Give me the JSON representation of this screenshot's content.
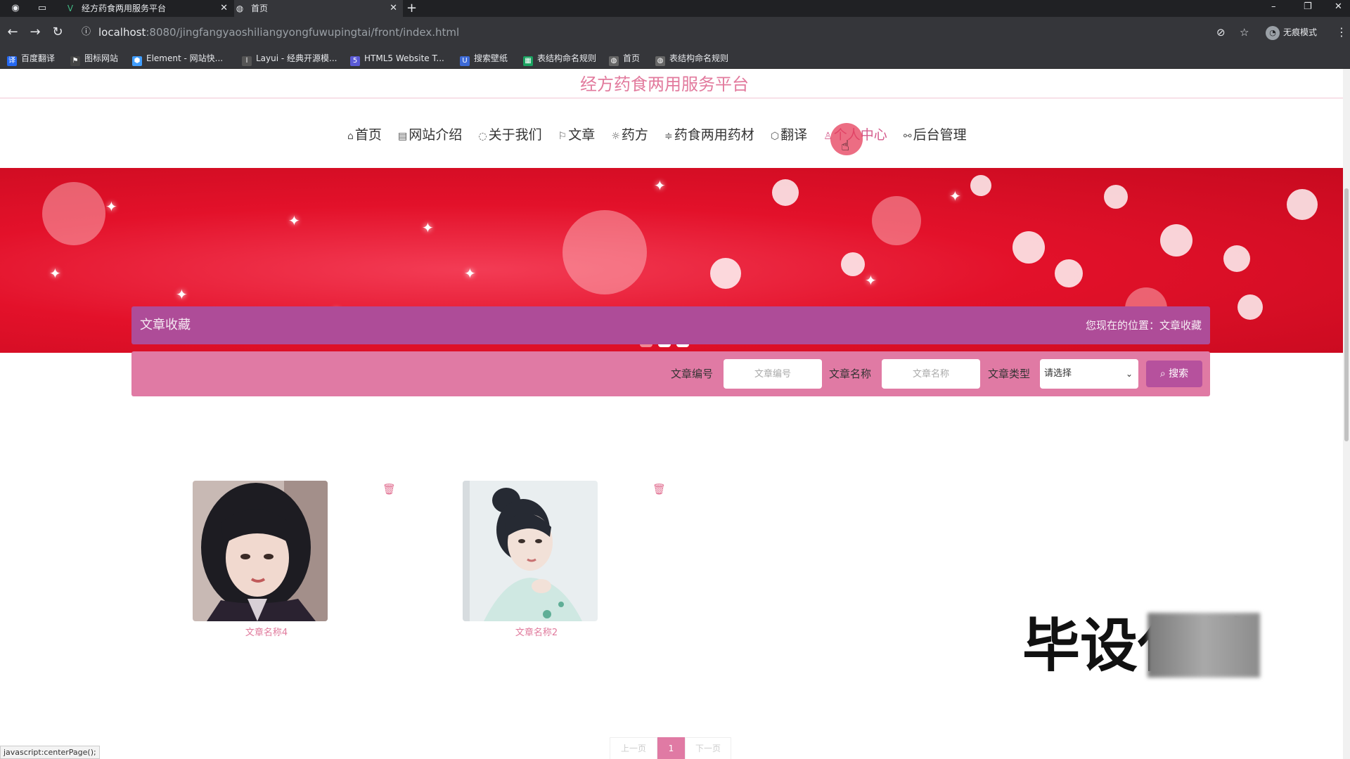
{
  "browser": {
    "tabs": [
      {
        "title": "经方药食两用服务平台",
        "icon": "vue-logo-icon",
        "active": false
      },
      {
        "title": "首页",
        "icon": "globe-icon",
        "active": true
      }
    ],
    "url_host": "localhost",
    "url_path": ":8080/jingfangyaoshiliangyongfuwupingtai/front/index.html",
    "profile_label": "无痕模式",
    "bookmarks": [
      {
        "label": "百度翻译",
        "icon": "baidu-translate-icon",
        "color": "#2468f2"
      },
      {
        "label": "图标网站",
        "icon": "flag-icon",
        "color": "#444444"
      },
      {
        "label": "Element - 网站快...",
        "icon": "element-icon",
        "color": "#409eff"
      },
      {
        "label": "Layui - 经典开源模...",
        "icon": "layui-icon",
        "color": "#555555"
      },
      {
        "label": "HTML5 Website T...",
        "icon": "html5-template-icon",
        "color": "#5b5bd6"
      },
      {
        "label": "搜索壁纸",
        "icon": "wallpaper-icon",
        "color": "#3d6ad6"
      },
      {
        "label": "表结构命名规则",
        "icon": "sheet-icon",
        "color": "#1aa260"
      },
      {
        "label": "首页",
        "icon": "globe-icon",
        "color": "#666666"
      },
      {
        "label": "表结构命名规则",
        "icon": "globe-icon",
        "color": "#666666"
      }
    ]
  },
  "site": {
    "title": "经方药食两用服务平台",
    "nav": [
      {
        "label": "首页",
        "icon": "home-icon",
        "glyph": "⌂",
        "active": false
      },
      {
        "label": "网站介绍",
        "icon": "calendar-icon",
        "glyph": "▤",
        "active": false
      },
      {
        "label": "关于我们",
        "icon": "power-icon",
        "glyph": "◌",
        "active": false
      },
      {
        "label": "文章",
        "icon": "flag-icon",
        "glyph": "⚐",
        "active": false
      },
      {
        "label": "药方",
        "icon": "gear-icon",
        "glyph": "☼",
        "active": false
      },
      {
        "label": "药食两用药材",
        "icon": "sliders-icon",
        "glyph": "≑",
        "active": false
      },
      {
        "label": "翻译",
        "icon": "cube-icon",
        "glyph": "⬡",
        "active": false
      },
      {
        "label": "个人中心",
        "icon": "user-icon",
        "glyph": "♙",
        "active": true
      },
      {
        "label": "后台管理",
        "icon": "link-icon",
        "glyph": "🔗",
        "active": false
      }
    ],
    "banner_slides": 3,
    "banner_active_slide": 2
  },
  "favorites": {
    "title": "文章收藏",
    "breadcrumb": "您现在的位置：文章收藏",
    "search": {
      "id_label": "文章编号",
      "id_placeholder": "文章编号",
      "name_label": "文章名称",
      "name_placeholder": "文章名称",
      "type_label": "文章类型",
      "type_selected": "请选择",
      "button_label": "搜索"
    },
    "items": [
      {
        "name": "文章名称4",
        "thumb": "portrait-dark-hair"
      },
      {
        "name": "文章名称2",
        "thumb": "portrait-light-bg"
      }
    ],
    "pager": {
      "prev": "上一页",
      "current": "1",
      "next": "下一页"
    }
  },
  "overlay": {
    "watermark": "毕设代做"
  },
  "status_text": "javascript:centerPage();",
  "colors": {
    "accent_pink": "#e07aa4",
    "header_purple": "#ae4c98",
    "title_pink": "#e27a9d",
    "banner_red": "#e3112a"
  }
}
